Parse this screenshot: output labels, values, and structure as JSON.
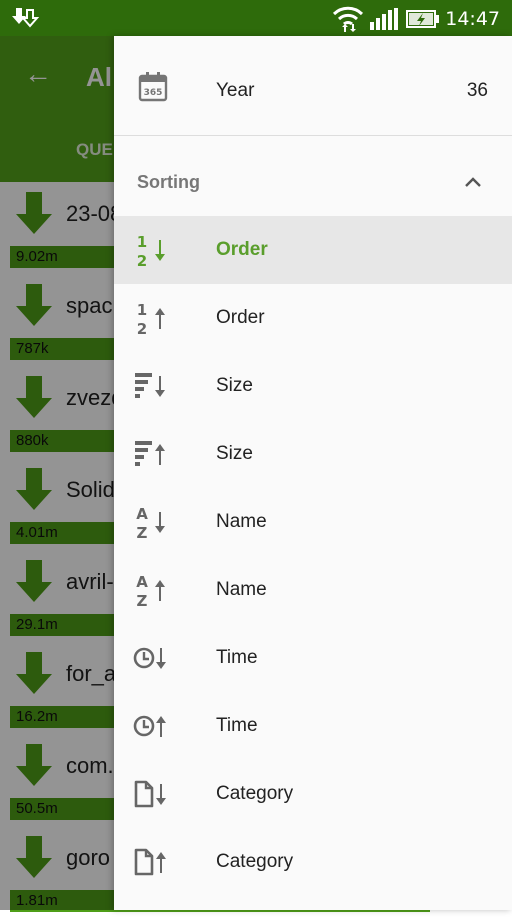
{
  "status_bar": {
    "time": "14:47"
  },
  "app_bar": {
    "back_icon": "arrow-left-icon",
    "title": "Al",
    "tab": "QUE"
  },
  "downloads": [
    {
      "name": "23-08",
      "size": "9.02m"
    },
    {
      "name": "spac",
      "size": "787k"
    },
    {
      "name": "zvezd",
      "size": "880k"
    },
    {
      "name": "Solid",
      "size": "4.01m"
    },
    {
      "name": "avril-",
      "size": "29.1m"
    },
    {
      "name": "for_a",
      "size": "16.2m"
    },
    {
      "name": "com.",
      "size": "50.5m"
    },
    {
      "name": "goro",
      "size": "1.81m"
    }
  ],
  "drawer": {
    "year": {
      "label": "Year",
      "value": "36",
      "icon": "calendar-365-icon"
    },
    "sorting": {
      "label": "Sorting",
      "expanded": true,
      "accent_color": "#5a9e2c",
      "items": [
        {
          "label": "Order",
          "icon": "sort-numeric-desc-icon",
          "active": true
        },
        {
          "label": "Order",
          "icon": "sort-numeric-asc-icon",
          "active": false
        },
        {
          "label": "Size",
          "icon": "sort-size-desc-icon",
          "active": false
        },
        {
          "label": "Size",
          "icon": "sort-size-asc-icon",
          "active": false
        },
        {
          "label": "Name",
          "icon": "sort-alpha-desc-icon",
          "active": false
        },
        {
          "label": "Name",
          "icon": "sort-alpha-asc-icon",
          "active": false
        },
        {
          "label": "Time",
          "icon": "sort-time-desc-icon",
          "active": false
        },
        {
          "label": "Time",
          "icon": "sort-time-asc-icon",
          "active": false
        },
        {
          "label": "Category",
          "icon": "sort-category-desc-icon",
          "active": false
        },
        {
          "label": "Category",
          "icon": "sort-category-asc-icon",
          "active": false
        }
      ]
    }
  }
}
